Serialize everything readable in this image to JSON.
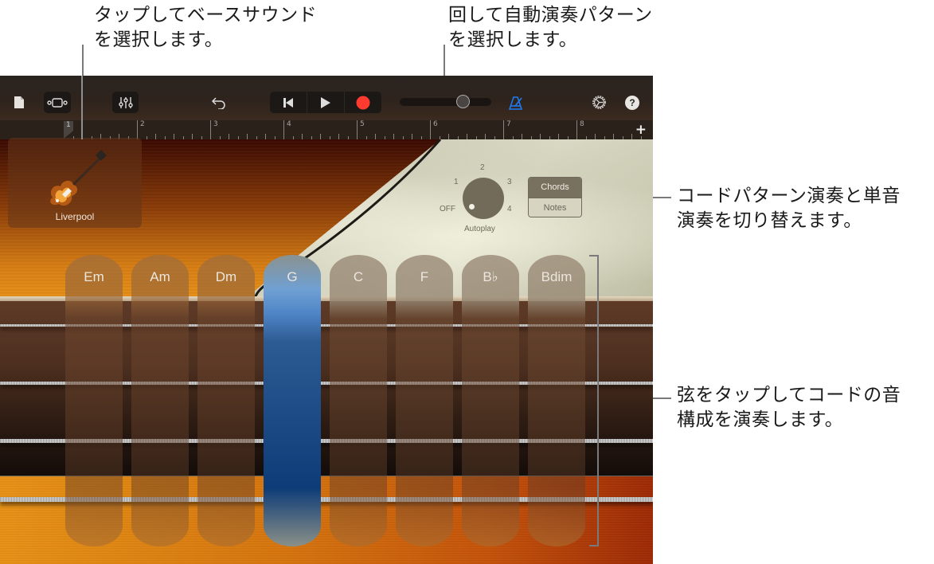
{
  "callouts": {
    "instrument": "タップしてベースサウンド\nを選択します。",
    "autoplay": "回して自動演奏パターン\nを選択します。",
    "chords_notes": "コードパターン演奏と単音\n演奏を切り替えます。",
    "strings": "弦をタップしてコードの音\n構成を演奏します。"
  },
  "toolbar": {
    "icons": [
      "document-icon",
      "track-view-icon",
      "mixer-icon",
      "undo-icon",
      "go-to-beginning-icon",
      "play-icon",
      "record-icon",
      "metronome-icon",
      "settings-icon",
      "help-icon"
    ],
    "volume_level": 0.72,
    "record_color": "#ff3b30",
    "metronome_color": "#1e7bf0",
    "help_label": "?"
  },
  "ruler": {
    "bars": [
      "1",
      "2",
      "3",
      "4",
      "5",
      "6",
      "7",
      "8"
    ],
    "add_label": "+"
  },
  "instrument": {
    "name": "Liverpool"
  },
  "autoplay": {
    "label": "Autoplay",
    "positions": [
      "OFF",
      "1",
      "2",
      "3",
      "4"
    ],
    "selected": "OFF"
  },
  "mode_toggle": {
    "options": [
      "Chords",
      "Notes"
    ],
    "selected": "Chords"
  },
  "chords": [
    {
      "label": "Em",
      "active": false
    },
    {
      "label": "Am",
      "active": false
    },
    {
      "label": "Dm",
      "active": false
    },
    {
      "label": "G",
      "active": true
    },
    {
      "label": "C",
      "active": false
    },
    {
      "label": "F",
      "active": false
    },
    {
      "label": "B♭",
      "active": false
    },
    {
      "label": "Bdim",
      "active": false
    }
  ],
  "strings_count": 4
}
